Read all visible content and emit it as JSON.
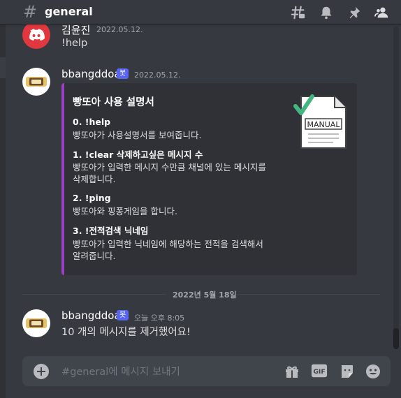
{
  "header": {
    "channel_name": "general",
    "icons": [
      "threads-icon",
      "bell-icon",
      "pin-icon",
      "members-icon"
    ]
  },
  "messages": [
    {
      "username": "김윤진",
      "timestamp": "2022.05.12.",
      "text": "!help",
      "avatar": "discord-logo-icon"
    },
    {
      "username": "bbangddoa",
      "bot_tag": "봇",
      "timestamp": "2022.05.12.",
      "avatar": "bread-icon",
      "embed": {
        "color": "#9b3fc9",
        "title": "빵또아 사용 설명서",
        "thumbnail_label": "MANUAL",
        "fields": [
          {
            "name": "0. !help",
            "value": "빵또아가 사용설명서를 보여줍니다."
          },
          {
            "name": "1. !clear 삭제하고싶은 메시지 수",
            "value_lines": [
              "빵또아가 입력한 메시지 수만큼 채널에 있는 메시지를",
              "삭제합니다."
            ]
          },
          {
            "name": "2. !ping",
            "value": "빵또아와 핑퐁게임을 합니다."
          },
          {
            "name": "3. !전적검색 닉네임",
            "value_lines": [
              "빵또아가 입력한 닉네임에 해당하는 전적을 검색해서",
              "알려줍니다."
            ]
          }
        ]
      }
    },
    {
      "username": "bbangddoa",
      "bot_tag": "봇",
      "timestamp": "오늘 오후 8:05",
      "text": "10 개의 메시지를 제거했어요!",
      "avatar": "bread-icon"
    }
  ],
  "date_divider": "2022년 5월 18일",
  "input": {
    "placeholder": "#general에 메시지 보내기",
    "gif_label": "GIF",
    "icons": [
      "add-attachment-icon",
      "gift-icon",
      "gif-icon",
      "sticker-icon",
      "emoji-icon"
    ]
  },
  "colors": {
    "background": "#36393f",
    "embed_bg": "#2f3136",
    "blurple": "#5865f2",
    "discord_red": "#e0383e"
  }
}
